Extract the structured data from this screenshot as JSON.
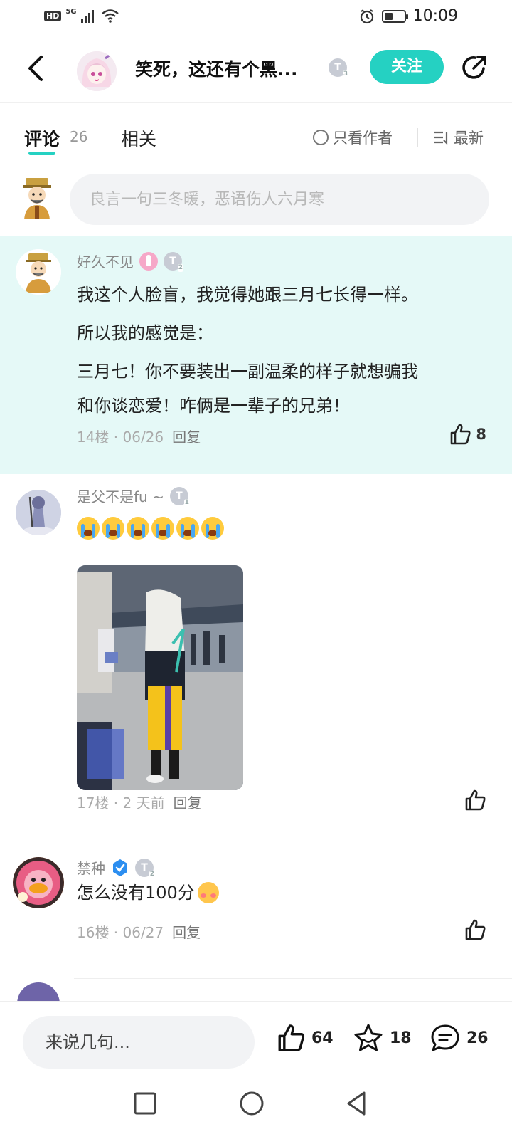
{
  "status_bar": {
    "time": "10:09",
    "hd": "HD",
    "network": "5G",
    "battery_level": 0.45
  },
  "header": {
    "title": "笑死，这还有个黑...",
    "level": "T",
    "level_num": "3",
    "follow_label": "关注"
  },
  "tabs": {
    "comments_label": "评论",
    "comments_count": "26",
    "related_label": "相关",
    "author_only_label": "只看作者",
    "sort_label": "最新"
  },
  "composer": {
    "placeholder": "良言一句三冬暖，恶语伤人六月寒"
  },
  "comments": [
    {
      "username": "好久不见",
      "level": "T",
      "level_num": "2",
      "lines": [
        "我这个人脸盲，我觉得她跟三月七长得一样。",
        "所以我的感觉是：",
        "三月七！你不要装出一副温柔的样子就想骗我",
        "和你谈恋爱！咋俩是一辈子的兄弟！"
      ],
      "floor": "14楼 · 06/26",
      "reply": "回复",
      "likes": "8"
    },
    {
      "username": "是父不是fu ~",
      "level": "T",
      "level_num": "1",
      "emoji": [
        "loudly-crying",
        "loudly-crying",
        "loudly-crying",
        "loudly-crying",
        "loudly-crying",
        "loudly-crying"
      ],
      "floor": "17楼 · 2 天前",
      "reply": "回复"
    },
    {
      "username": "禁种",
      "level": "T",
      "level_num": "2",
      "text": "怎么没有100分",
      "floor": "16楼 · 06/27",
      "reply": "回复"
    }
  ],
  "bottom_bar": {
    "say_placeholder": "来说几句...",
    "likes": "64",
    "favorites": "18",
    "comments": "26"
  },
  "colors": {
    "accent": "#25d1c2",
    "highlight_bg": "#e5f9f7"
  },
  "icons": [
    "back-icon",
    "share-icon",
    "like-icon",
    "star-icon",
    "comment-icon",
    "sort-icon",
    "radio-icon",
    "square-icon",
    "circle-icon",
    "triangle-back-icon",
    "verified-icon"
  ]
}
